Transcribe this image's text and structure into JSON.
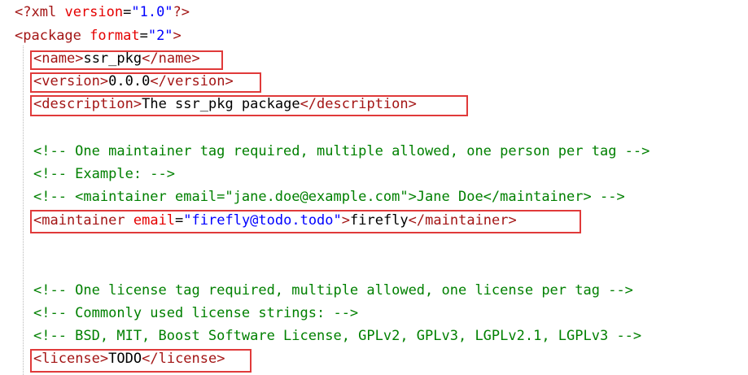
{
  "lines": {
    "xml_decl": {
      "open": "<?",
      "tag": "xml",
      "attr": "version",
      "eq": "=",
      "value": "\"1.0\"",
      "close": "?>"
    },
    "package_open": {
      "open": "<",
      "tag": "package",
      "attr": "format",
      "eq": "=",
      "value": "\"2\"",
      "close": ">"
    },
    "name": {
      "open": "<",
      "tag": "name",
      "close": ">",
      "text": "ssr_pkg",
      "end_open": "</",
      "end_tag": "name",
      "end_close": ">"
    },
    "version": {
      "open": "<",
      "tag": "version",
      "close": ">",
      "text": "0.0.0",
      "end_open": "</",
      "end_tag": "version",
      "end_close": ">"
    },
    "description": {
      "open": "<",
      "tag": "description",
      "close": ">",
      "text": "The ssr_pkg package",
      "end_open": "</",
      "end_tag": "description",
      "end_close": ">"
    },
    "comment_maint_1": "<!-- One maintainer tag required, multiple allowed, one person per tag -->",
    "comment_maint_2": "<!-- Example:  -->",
    "comment_maint_3": "<!-- <maintainer email=\"jane.doe@example.com\">Jane Doe</maintainer> -->",
    "maintainer": {
      "open": "<",
      "tag": "maintainer",
      "attr": "email",
      "eq": "=",
      "value": "\"firefly@todo.todo\"",
      "close": ">",
      "text": "firefly",
      "end_open": "</",
      "end_tag": "maintainer",
      "end_close": ">"
    },
    "comment_lic_1": "<!-- One license tag required, multiple allowed, one license per tag -->",
    "comment_lic_2": "<!-- Commonly used license strings: -->",
    "comment_lic_3": "<!--   BSD, MIT, Boost Software License, GPLv2, GPLv3, LGPLv2.1, LGPLv3 -->",
    "license": {
      "open": "<",
      "tag": "license",
      "close": ">",
      "text": "TODO",
      "end_open": "</",
      "end_tag": "license",
      "end_close": ">"
    }
  },
  "colors": {
    "tag": "#a31515",
    "attribute": "#e50000",
    "attribute_value": "#0000ff",
    "text": "#000000",
    "comment": "#008000",
    "highlight_box": "#e03a3a",
    "background": "#ffffff"
  }
}
